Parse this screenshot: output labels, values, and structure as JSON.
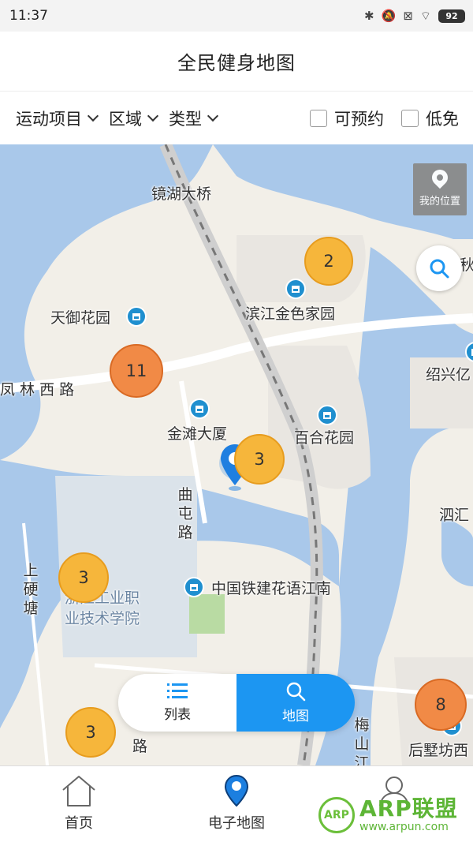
{
  "status_bar": {
    "time": "11:37",
    "battery": "92"
  },
  "header": {
    "title": "全民健身地图"
  },
  "filters": {
    "dropdowns": [
      "运动项目",
      "区域",
      "类型"
    ],
    "checkboxes": [
      "可预约",
      "低免"
    ]
  },
  "map": {
    "my_location_label": "我的位置",
    "places": {
      "bridge": "镜湖大桥",
      "tianyu": "天御花园",
      "binjiang": "滨江金色家园",
      "fenglin": "凤 林 西 路",
      "jintan": "金滩大厦",
      "baihe": "百合花园",
      "shaoxing": "绍兴亿",
      "sihui": "泗汇",
      "qutun": "曲屯路",
      "shangying": "上硬塘",
      "zhongtie": "中国铁建花语江南",
      "college": "浙江工业职业技术学院",
      "qiu": "秋",
      "houshu": "后墅坊西",
      "meishan": "梅山江",
      "lu_fragment": "路"
    },
    "clusters": [
      "2",
      "11",
      "3",
      "3",
      "3",
      "8"
    ]
  },
  "view_toggle": {
    "list": "列表",
    "map": "地图"
  },
  "bottom_nav": [
    "首页",
    "电子地图",
    ""
  ],
  "watermark": {
    "brand": "ARP联盟",
    "badge": "ARP",
    "url": "www.arpun.com"
  },
  "colors": {
    "accent": "#1c96f2",
    "water": "#a9c8ea",
    "cluster_yellow": "#f6b63b",
    "cluster_orange": "#f18a46"
  }
}
